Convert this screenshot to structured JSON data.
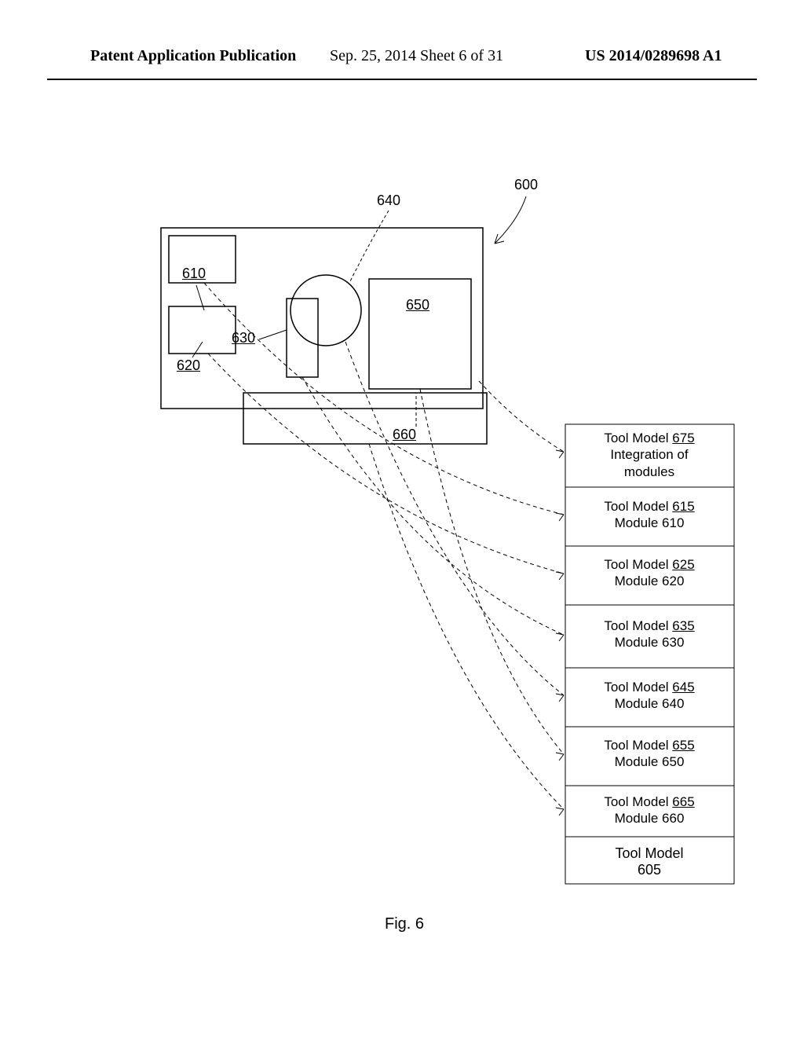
{
  "header": {
    "left": "Patent Application Publication",
    "center": "Sep. 25, 2014  Sheet 6 of 31",
    "right": "US 2014/0289698 A1"
  },
  "callouts": {
    "c600": "600",
    "c640": "640",
    "c610": "610",
    "c650": "650",
    "c620": "620",
    "c630": "630",
    "c660": "660"
  },
  "tool_models": {
    "tm675": {
      "line1_a": "Tool Model ",
      "line1_b": "675",
      "line2": "Integration of",
      "line3": "modules"
    },
    "tm615": {
      "line1_a": "Tool Model ",
      "line1_b": "615",
      "line2": "Module 610"
    },
    "tm625": {
      "line1_a": "Tool Model ",
      "line1_b": "625",
      "line2": "Module 620"
    },
    "tm635": {
      "line1_a": "Tool Model ",
      "line1_b": "635",
      "line2": "Module 630"
    },
    "tm645": {
      "line1_a": "Tool Model ",
      "line1_b": "645",
      "line2": "Module 640"
    },
    "tm655": {
      "line1_a": "Tool Model ",
      "line1_b": "655",
      "line2": "Module 650"
    },
    "tm665": {
      "line1_a": "Tool Model ",
      "line1_b": "665",
      "line2": "Module 660"
    },
    "title_a": "Tool Model",
    "title_b": "605"
  },
  "figcap": "Fig. 6"
}
